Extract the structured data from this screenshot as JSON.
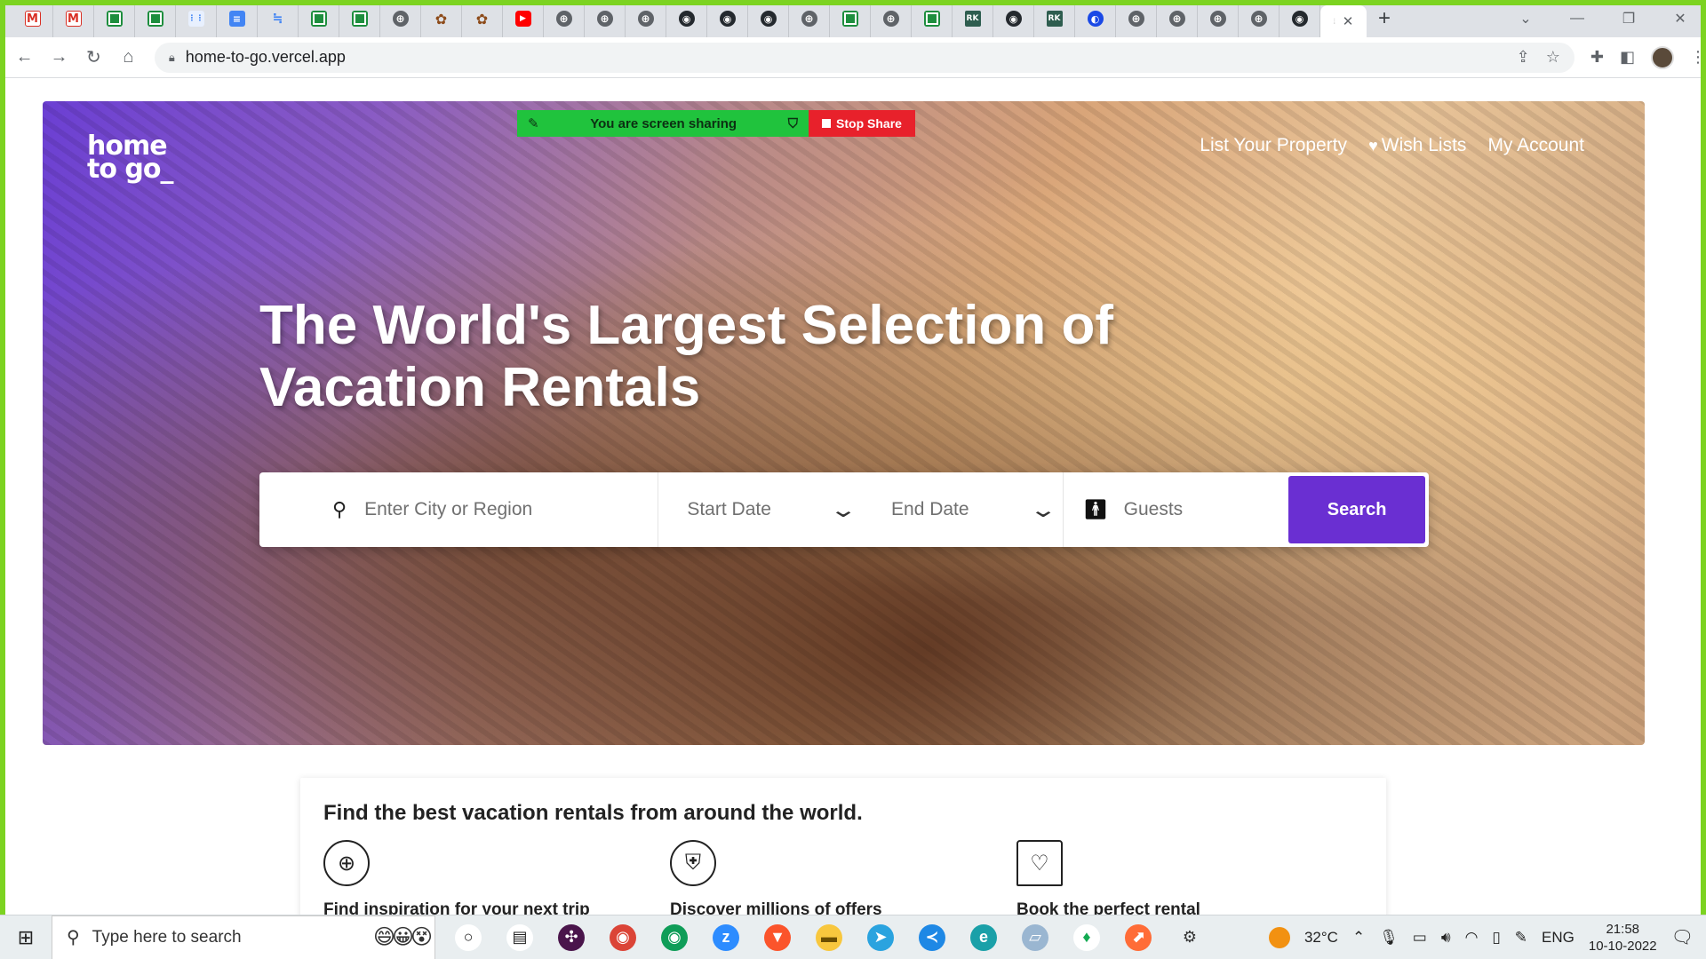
{
  "browser": {
    "tab_favicons": [
      "gmail",
      "gmail",
      "sheets",
      "sheets",
      "dots",
      "docs",
      "flow",
      "sheets",
      "sheets",
      "globe",
      "pin",
      "pin",
      "yt",
      "globe",
      "globe",
      "globe",
      "gh",
      "gh",
      "gh",
      "globe",
      "sheets",
      "globe",
      "sheets",
      "rk",
      "gh",
      "rk",
      "blue",
      "globe",
      "globe",
      "globe",
      "globe",
      "gh"
    ],
    "rk_label": "RK",
    "active_tab_close": "✕",
    "url": "home-to-go.vercel.app"
  },
  "screen_share": {
    "message": "You are screen sharing",
    "stop_label": "Stop Share"
  },
  "site": {
    "logo_line1": "home",
    "logo_line2": "to go_",
    "nav": {
      "list_property": "List Your Property",
      "wish_lists": "Wish Lists",
      "my_account": "My Account"
    },
    "headline": "The World's Largest Selection of Vacation Rentals",
    "search": {
      "city_placeholder": "Enter City or Region",
      "start_date": "Start Date",
      "end_date": "End Date",
      "guests": "Guests",
      "button": "Search"
    },
    "card": {
      "title": "Find the best vacation rentals from around the world.",
      "features": [
        {
          "icon": "globe-location-icon",
          "text": "Find inspiration for your next trip"
        },
        {
          "icon": "verified-user-icon",
          "text": "Discover millions of offers"
        },
        {
          "icon": "house-heart-icon",
          "text": "Book the perfect rental"
        }
      ]
    }
  },
  "taskbar": {
    "search_placeholder": "Type here to search",
    "apps": [
      "task-view",
      "widgets",
      "slack",
      "chrome",
      "chrome-profile",
      "zoom",
      "brave",
      "file-explorer",
      "telegram",
      "vscode",
      "edge",
      "notepad",
      "mongodb",
      "postman",
      "settings"
    ],
    "weather": "32°C",
    "language": "ENG",
    "time": "21:58",
    "date": "10-10-2022"
  },
  "colors": {
    "accent_purple": "#6a2fd2",
    "share_green": "#20c33d",
    "share_red": "#e8212b",
    "frame_green": "#7cd321"
  }
}
